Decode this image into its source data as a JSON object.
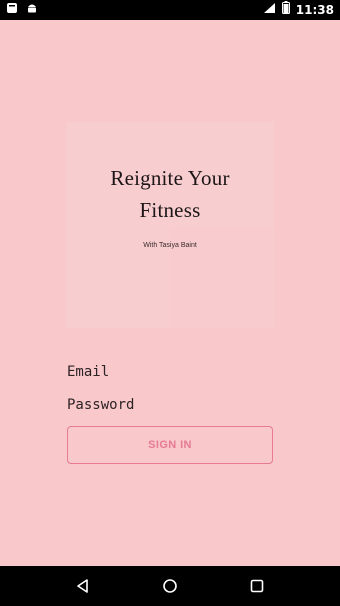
{
  "status_bar": {
    "time": "11:38",
    "left_icons": [
      "notification-icon",
      "android-icon"
    ],
    "right_icons": [
      "signal-icon",
      "battery-icon"
    ]
  },
  "hero": {
    "title_line1": "Reignite Your",
    "title_line2": "Fitness",
    "subtitle": "With Tasiya Baint"
  },
  "form": {
    "email_placeholder": "Email",
    "password_placeholder": "Password",
    "signin_label": "SIGN IN"
  },
  "nav_bar": {
    "buttons": [
      "back-icon",
      "home-icon",
      "recents-icon"
    ]
  },
  "colors": {
    "background": "#f8c8cb",
    "accent": "#e77a95",
    "text": "#1c1616"
  }
}
